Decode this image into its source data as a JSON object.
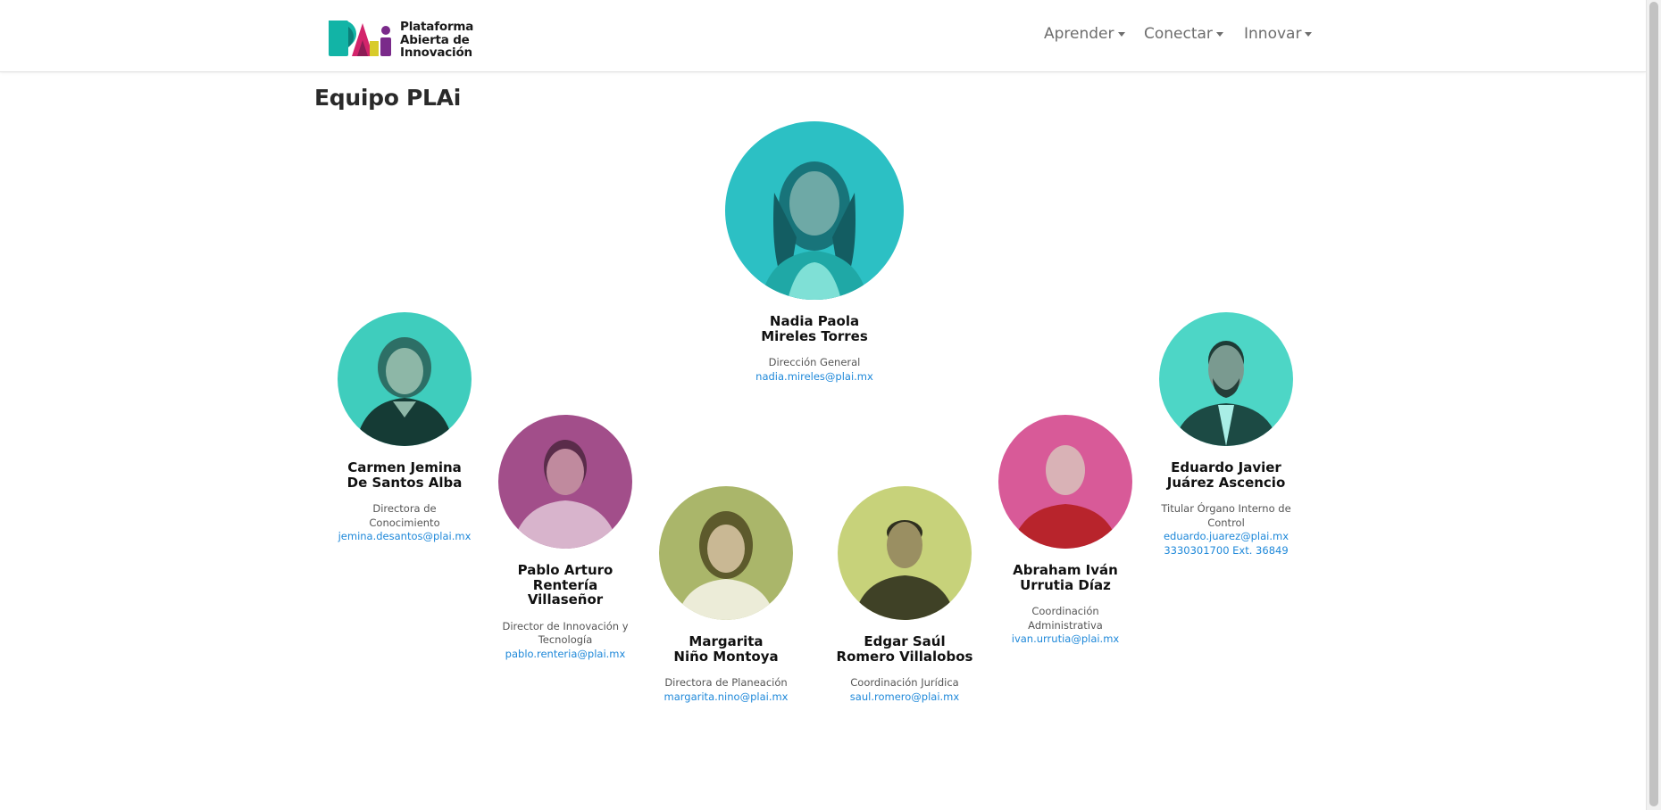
{
  "header": {
    "logo": {
      "line1": "Plataforma",
      "line2": "Abierta de",
      "line3": "Innovación",
      "colors": {
        "teal": "#12b4a6",
        "magenta": "#d3246b",
        "purple": "#7a2a8a",
        "yellow": "#d8cb2a"
      }
    },
    "nav": [
      {
        "label": "Aprender"
      },
      {
        "label": "Conectar"
      },
      {
        "label": "Innovar"
      }
    ]
  },
  "page": {
    "title": "Equipo PLAi"
  },
  "team": [
    {
      "name_line1": "Nadia Paola",
      "name_line2": "Mireles Torres",
      "role": "Dirección General",
      "email": "nadia.mireles@plai.mx",
      "bg": "#2cc0c4"
    },
    {
      "name_line1": "Carmen Jemina",
      "name_line2": "De Santos Alba",
      "role": "Directora de Conocimiento",
      "email": "jemina.desantos@plai.mx",
      "bg": "#3fcdbd"
    },
    {
      "name_line1": "Pablo Arturo",
      "name_line2": "Rentería",
      "name_line3": "Villaseñor",
      "role": "Director de Innovación y Tecnología",
      "email": "pablo.renteria@plai.mx",
      "bg": "#a24e8a"
    },
    {
      "name_line1": "Margarita",
      "name_line2": "Niño Montoya",
      "role": "Directora de Planeación",
      "email": "margarita.nino@plai.mx",
      "bg": "#aab66a"
    },
    {
      "name_line1": "Edgar Saúl",
      "name_line2": "Romero Villalobos",
      "role": "Coordinación Jurídica",
      "email": "saul.romero@plai.mx",
      "bg": "#c7d27a"
    },
    {
      "name_line1": "Abraham Iván",
      "name_line2": "Urrutia Díaz",
      "role": "Coordinación Administrativa",
      "email": "ivan.urrutia@plai.mx",
      "bg": "#d85a98"
    },
    {
      "name_line1": "Eduardo Javier",
      "name_line2": "Juárez Ascencio",
      "role": "Titular Órgano Interno de Control",
      "email": "eduardo.juarez@plai.mx",
      "phone": "3330301700 Ext. 36849",
      "bg": "#4dd6c6"
    }
  ]
}
